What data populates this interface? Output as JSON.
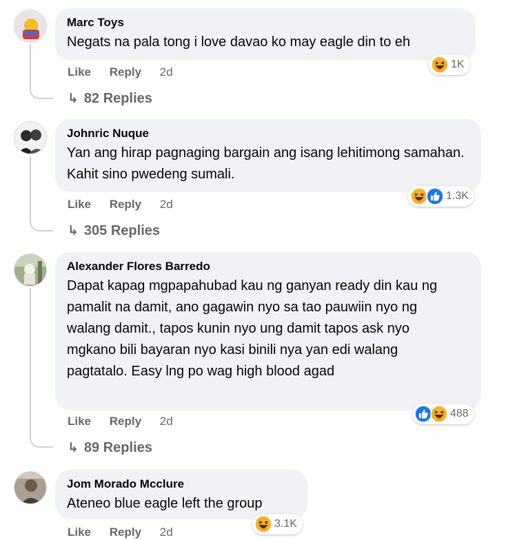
{
  "comments": [
    {
      "author": "Marc Toys",
      "text": "Negats na pala tong i love davao ko may eagle din to eh",
      "like": "Like",
      "reply": "Reply",
      "time": "2d",
      "reaction_count": "1K",
      "reactions": [
        "haha"
      ],
      "replies": "82 Replies"
    },
    {
      "author": "Johnric Nuque",
      "text": "Yan ang hirap pagnaging bargain ang isang lehitimong samahan. Kahit sino pwedeng sumali.",
      "like": "Like",
      "reply": "Reply",
      "time": "2d",
      "reaction_count": "1.3K",
      "reactions": [
        "haha",
        "like"
      ],
      "replies": "305 Replies"
    },
    {
      "author": "Alexander Flores Barredo",
      "text": "Dapat kapag mgpapahubad kau ng ganyan ready din kau ng pamalit na damit, ano gagawin nyo sa tao pauwiin nyo ng walang damit., tapos kunin nyo ung damit tapos ask nyo mgkano bili bayaran nyo kasi binili nya yan edi walang pagtatalo. Easy lng po wag high blood agad",
      "like": "Like",
      "reply": "Reply",
      "time": "2d",
      "reaction_count": "488",
      "reactions": [
        "like",
        "haha"
      ],
      "replies": "89 Replies"
    },
    {
      "author": "Jom Morado Mcclure",
      "text": "Ateneo blue eagle left the group",
      "like": "Like",
      "reply": "Reply",
      "time": "2d",
      "reaction_count": "3.1K",
      "reactions": [
        "haha"
      ]
    }
  ],
  "icons": {
    "reply_arrow": "reply-arrow-icon",
    "haha": "haha-reaction-icon",
    "like": "like-reaction-icon"
  },
  "colors": {
    "bubble": "#f0f2f5",
    "meta": "#65676b",
    "like_blue": "#1877f2",
    "haha_yellow": "#f7b125"
  }
}
